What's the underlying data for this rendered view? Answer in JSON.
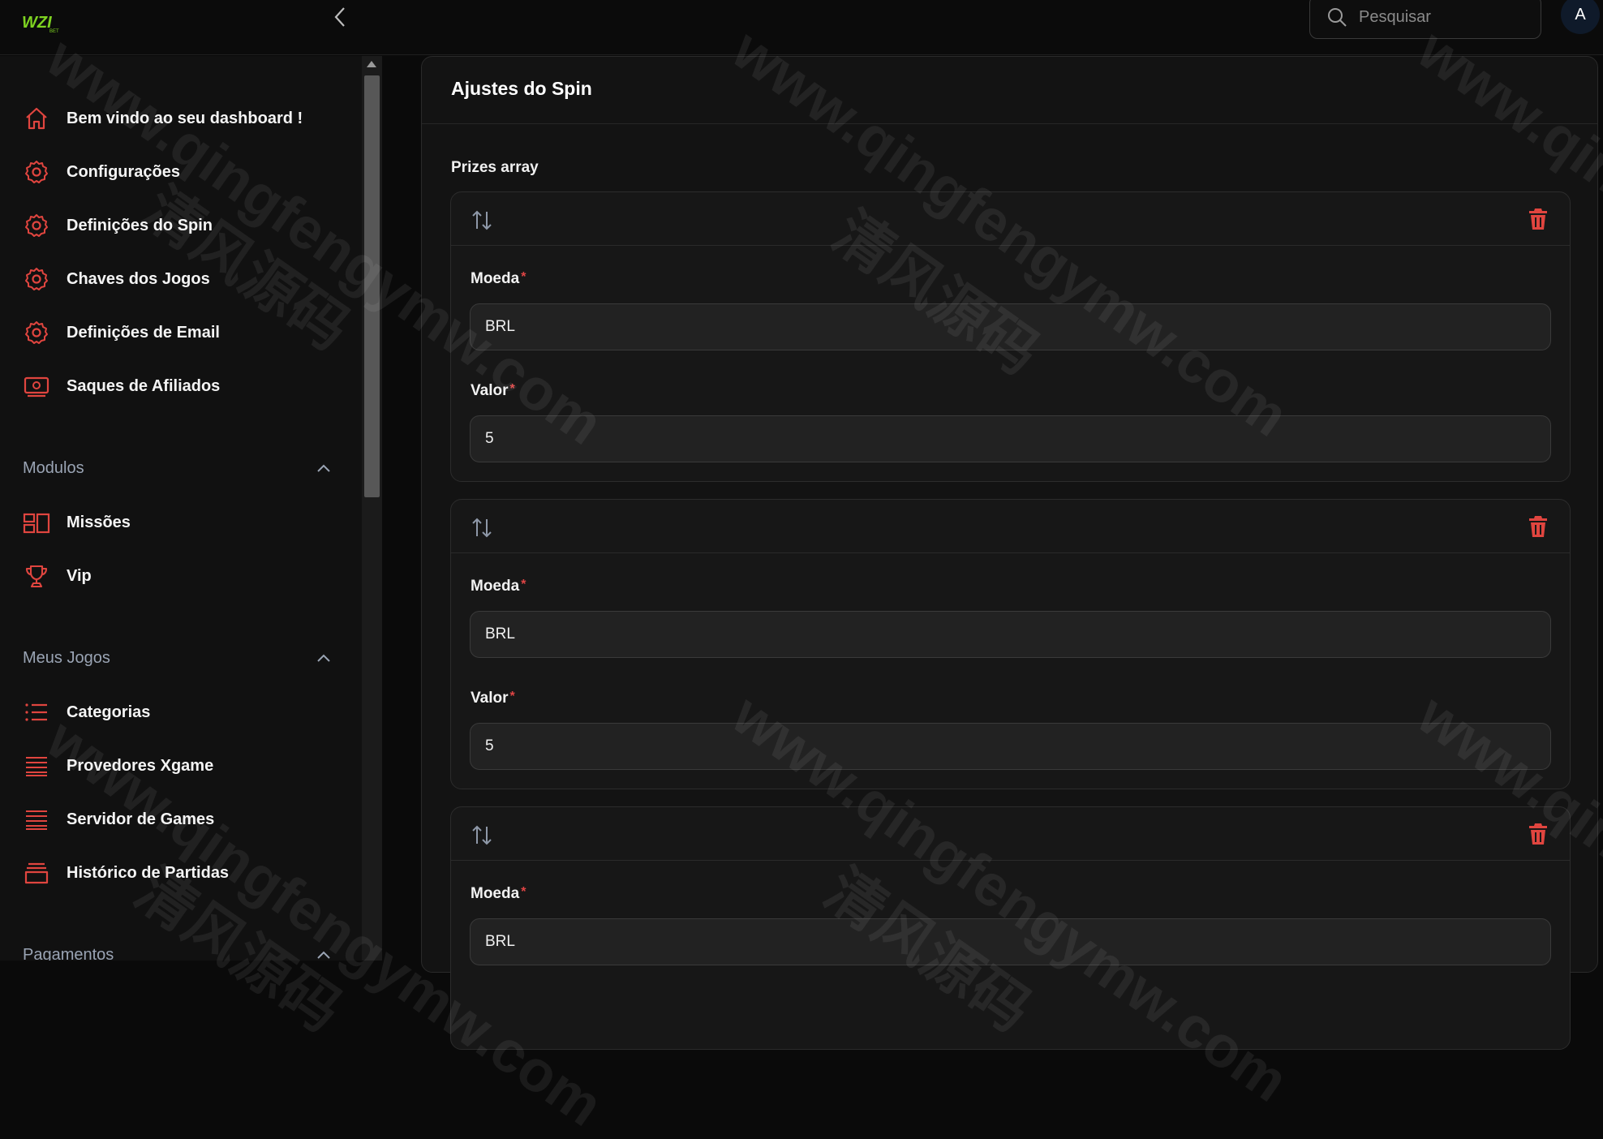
{
  "header": {
    "logo_text": "WZI",
    "search_placeholder": "Pesquisar",
    "avatar_initial": "A"
  },
  "sidebar": {
    "items": [
      {
        "label": "Bem vindo ao seu dashboard !",
        "icon": "home-icon"
      },
      {
        "label": "Configurações",
        "icon": "gear-icon"
      },
      {
        "label": "Definições do Spin",
        "icon": "gear-icon"
      },
      {
        "label": "Chaves dos Jogos",
        "icon": "gear-icon"
      },
      {
        "label": "Definições de Email",
        "icon": "gear-icon"
      },
      {
        "label": "Saques de Afiliados",
        "icon": "money-icon"
      }
    ],
    "groups": [
      {
        "label": "Modulos",
        "items": [
          {
            "label": "Missões",
            "icon": "layout-icon"
          },
          {
            "label": "Vip",
            "icon": "trophy-icon"
          }
        ]
      },
      {
        "label": "Meus Jogos",
        "items": [
          {
            "label": "Categorias",
            "icon": "list-icon"
          },
          {
            "label": "Provedores Xgame",
            "icon": "stack-icon"
          },
          {
            "label": "Servidor de Games",
            "icon": "stack-icon"
          },
          {
            "label": "Histórico de Partidas",
            "icon": "box-icon"
          }
        ]
      },
      {
        "label": "Pagamentos"
      }
    ]
  },
  "main": {
    "title": "Ajustes do Spin",
    "section_label": "Prizes array",
    "prizes": [
      {
        "moeda_label": "Moeda",
        "moeda": "BRL",
        "valor_label": "Valor",
        "valor": "5"
      },
      {
        "moeda_label": "Moeda",
        "moeda": "BRL",
        "valor_label": "Valor",
        "valor": "5"
      },
      {
        "moeda_label": "Moeda",
        "moeda": "BRL"
      }
    ]
  },
  "colors": {
    "accent": "#e0453f",
    "logo": "#7ed321"
  },
  "watermark": {
    "text": "www.qingfengymw.com",
    "text_cn": "清风源码"
  }
}
